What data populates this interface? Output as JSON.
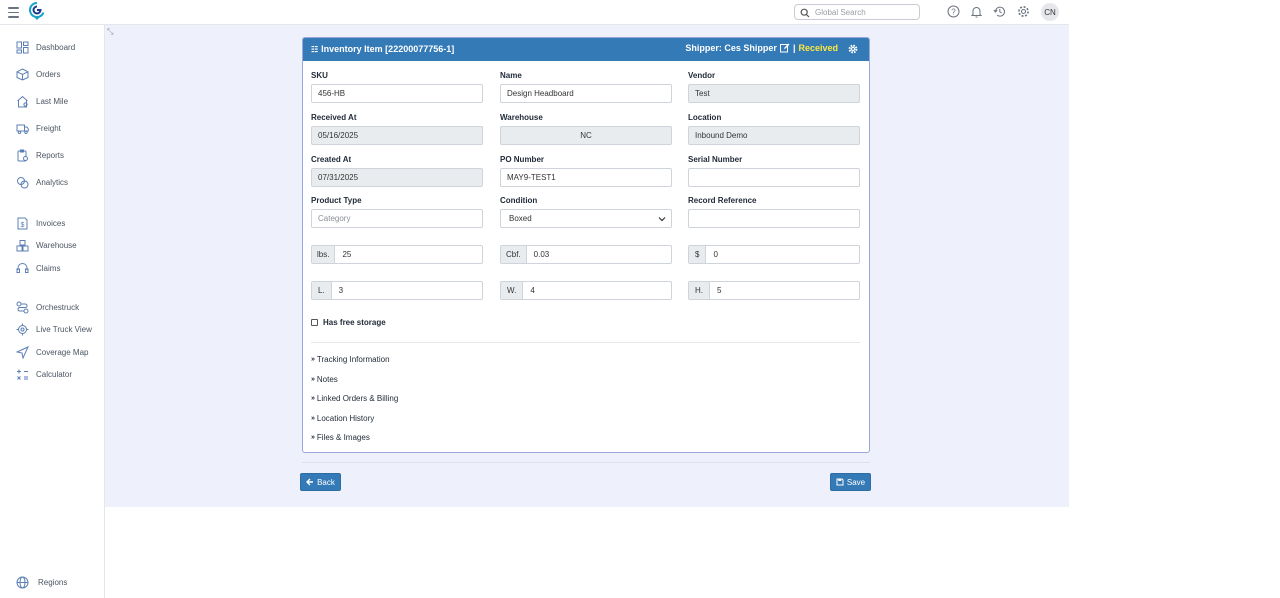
{
  "search": {
    "placeholder": "Global Search"
  },
  "user": {
    "initials": "CN"
  },
  "sidebar": {
    "items": [
      {
        "label": "Dashboard",
        "icon": "dashboard-icon"
      },
      {
        "label": "Orders",
        "icon": "box-icon"
      },
      {
        "label": "Last Mile",
        "icon": "house-icon"
      },
      {
        "label": "Freight",
        "icon": "truck-icon"
      },
      {
        "label": "Reports",
        "icon": "report-icon"
      },
      {
        "label": "Analytics",
        "icon": "analytics-icon"
      },
      {
        "label": "Invoices",
        "icon": "invoice-icon"
      },
      {
        "label": "Warehouse",
        "icon": "warehouse-icon"
      },
      {
        "label": "Claims",
        "icon": "headset-icon"
      },
      {
        "label": "Orchestruck",
        "icon": "route-icon"
      },
      {
        "label": "Live Truck View",
        "icon": "target-icon"
      },
      {
        "label": "Coverage Map",
        "icon": "send-icon"
      },
      {
        "label": "Calculator",
        "icon": "calculator-icon"
      }
    ],
    "regions": {
      "label": "Regions",
      "icon": "globe-icon"
    }
  },
  "card": {
    "title": "Inventory Item [22200077756-1]",
    "shipper_label": "Shipper: Ces Shipper",
    "separator": "|",
    "status": "Received",
    "status_color": "#ffe83d",
    "header_color": "#337ab7"
  },
  "form": {
    "sku": {
      "label": "SKU",
      "value": "456-HB"
    },
    "name": {
      "label": "Name",
      "value": "Design Headboard"
    },
    "vendor": {
      "label": "Vendor",
      "value": "Test"
    },
    "received_at": {
      "label": "Received At",
      "value": "05/16/2025"
    },
    "warehouse": {
      "label": "Warehouse",
      "value": "NC"
    },
    "location": {
      "label": "Location",
      "value": "Inbound Demo"
    },
    "created_at": {
      "label": "Created At",
      "value": "07/31/2025"
    },
    "po_number": {
      "label": "PO Number",
      "value": "MAY9-TEST1"
    },
    "serial_number": {
      "label": "Serial Number",
      "value": ""
    },
    "product_type": {
      "label": "Product Type",
      "placeholder": "Category"
    },
    "condition": {
      "label": "Condition",
      "value": "Boxed"
    },
    "record_reference": {
      "label": "Record Reference",
      "value": ""
    },
    "weight": {
      "addon": "lbs.",
      "value": "25"
    },
    "cube": {
      "addon": "Cbf.",
      "value": "0.03"
    },
    "price": {
      "addon": "$",
      "value": "0"
    },
    "length": {
      "addon": "L.",
      "value": "3"
    },
    "width": {
      "addon": "W.",
      "value": "4"
    },
    "height": {
      "addon": "H.",
      "value": "5"
    },
    "free_storage": {
      "label": "Has free storage",
      "checked": false
    }
  },
  "sections": [
    "Tracking Information",
    "Notes",
    "Linked Orders & Billing",
    "Location History",
    "Files & Images"
  ],
  "buttons": {
    "back": "Back",
    "save": "Save"
  }
}
